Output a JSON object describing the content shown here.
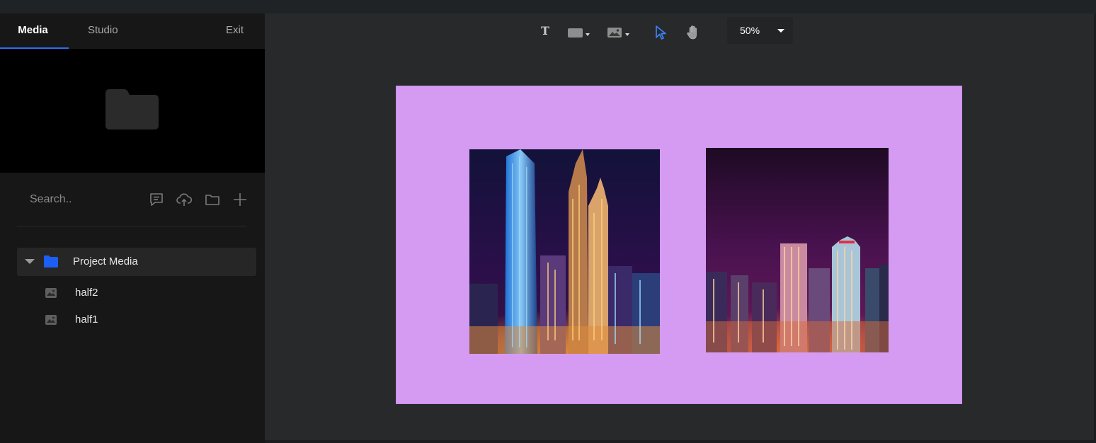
{
  "sidebar": {
    "tabs": [
      {
        "label": "Media",
        "active": true
      },
      {
        "label": "Studio",
        "active": false
      }
    ],
    "exit_label": "Exit",
    "preview_icon": "folder-icon",
    "search": {
      "placeholder": "Search..",
      "value": ""
    },
    "toolbar_icons": [
      "comment-icon",
      "cloud-upload-icon",
      "folder-icon",
      "plus-icon"
    ],
    "tree": {
      "root_label": "Project Media",
      "items": [
        {
          "label": "half2",
          "icon": "image-icon"
        },
        {
          "label": "half1",
          "icon": "image-icon"
        }
      ]
    }
  },
  "editor": {
    "toolbar": {
      "text_tool": {
        "glyph": "T",
        "icon": "text-tool-icon"
      },
      "shape_tool": "rectangle-icon",
      "image_tool": "image-icon",
      "select_tool": "pointer-icon",
      "pan_tool": "hand-icon",
      "zoom": "50%"
    },
    "canvas": {
      "background": "#d59bf2",
      "images": [
        {
          "name": "half1",
          "subject": "night city skyline"
        },
        {
          "name": "half2",
          "subject": "night city skyline"
        }
      ]
    }
  },
  "colors": {
    "accent": "#2c6ef2",
    "folder_blue": "#1d5ef5",
    "select_tool": "#3b82f6"
  }
}
